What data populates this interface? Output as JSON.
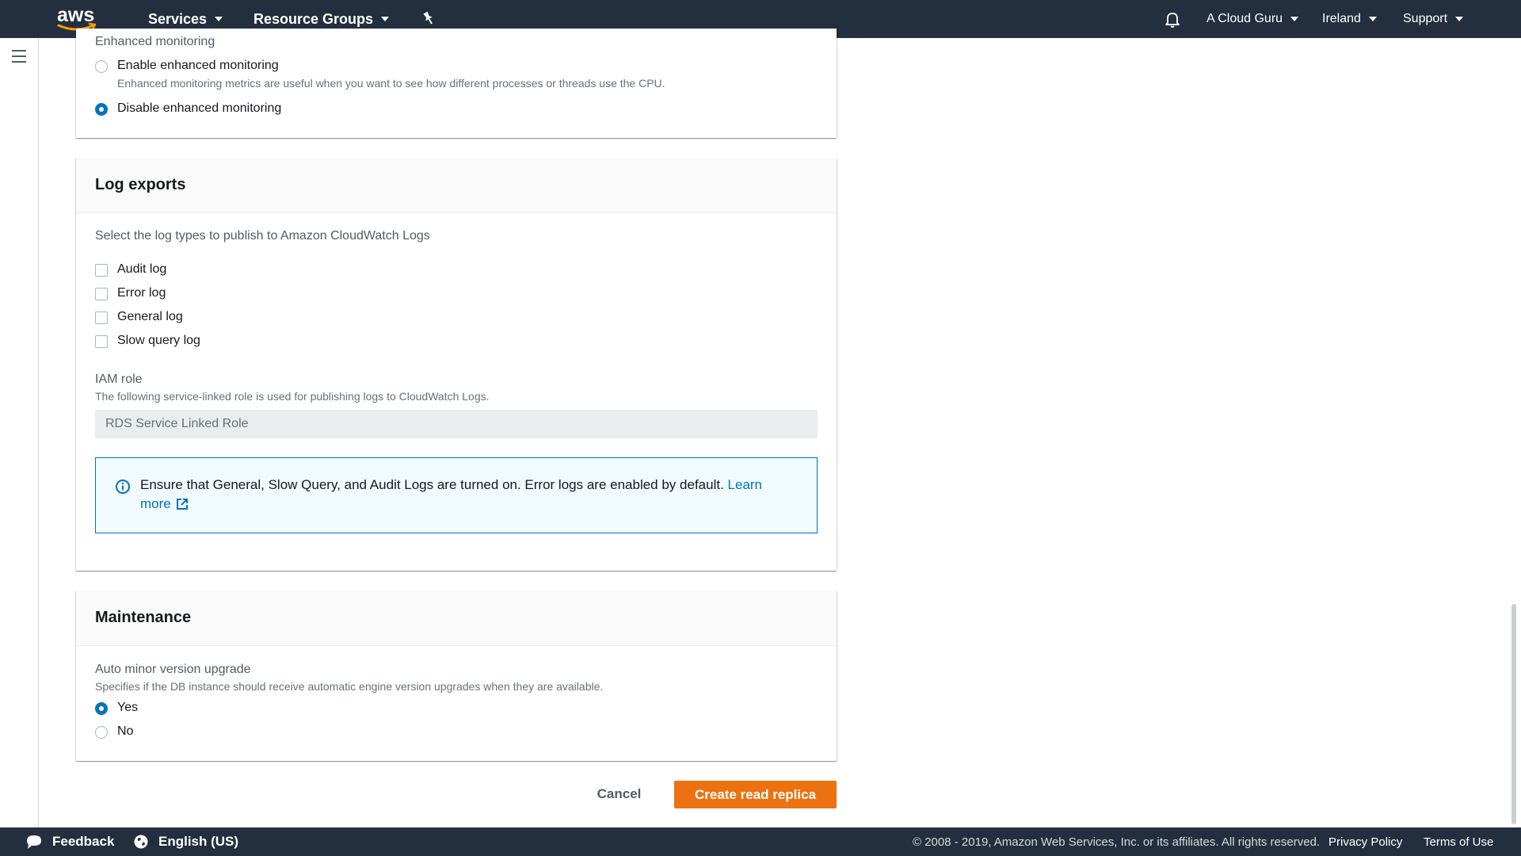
{
  "topnav": {
    "logo_text": "aws",
    "services": "Services",
    "resource_groups": "Resource Groups",
    "account": "A Cloud Guru",
    "region": "Ireland",
    "support": "Support"
  },
  "monitoring": {
    "section_label": "Enhanced monitoring",
    "enable_label": "Enable enhanced monitoring",
    "enable_desc": "Enhanced monitoring metrics are useful when you want to see how different processes or threads use the CPU.",
    "disable_label": "Disable enhanced monitoring",
    "selected": "disable"
  },
  "log_exports": {
    "title": "Log exports",
    "intro": "Select the log types to publish to Amazon CloudWatch Logs",
    "options": [
      {
        "label": "Audit log",
        "checked": false
      },
      {
        "label": "Error log",
        "checked": false
      },
      {
        "label": "General log",
        "checked": false
      },
      {
        "label": "Slow query log",
        "checked": false
      }
    ],
    "iam_label": "IAM role",
    "iam_desc": "The following service-linked role is used for publishing logs to CloudWatch Logs.",
    "iam_value": "RDS Service Linked Role",
    "info_text": "Ensure that General, Slow Query, and Audit Logs are turned on. Error logs are enabled by default.",
    "info_link": "Learn more"
  },
  "maintenance": {
    "title": "Maintenance",
    "upgrade_label": "Auto minor version upgrade",
    "upgrade_desc": "Specifies if the DB instance should receive automatic engine version upgrades when they are available.",
    "yes_label": "Yes",
    "no_label": "No",
    "selected": "yes"
  },
  "actions": {
    "cancel": "Cancel",
    "create": "Create read replica"
  },
  "footer": {
    "feedback": "Feedback",
    "language": "English (US)",
    "copyright": "© 2008 - 2019, Amazon Web Services, Inc. or its affiliates. All rights reserved.",
    "privacy": "Privacy Policy",
    "terms": "Terms of Use"
  },
  "colors": {
    "nav_bg": "#232f3e",
    "accent_blue": "#0073bb",
    "primary_orange": "#ec7211"
  }
}
